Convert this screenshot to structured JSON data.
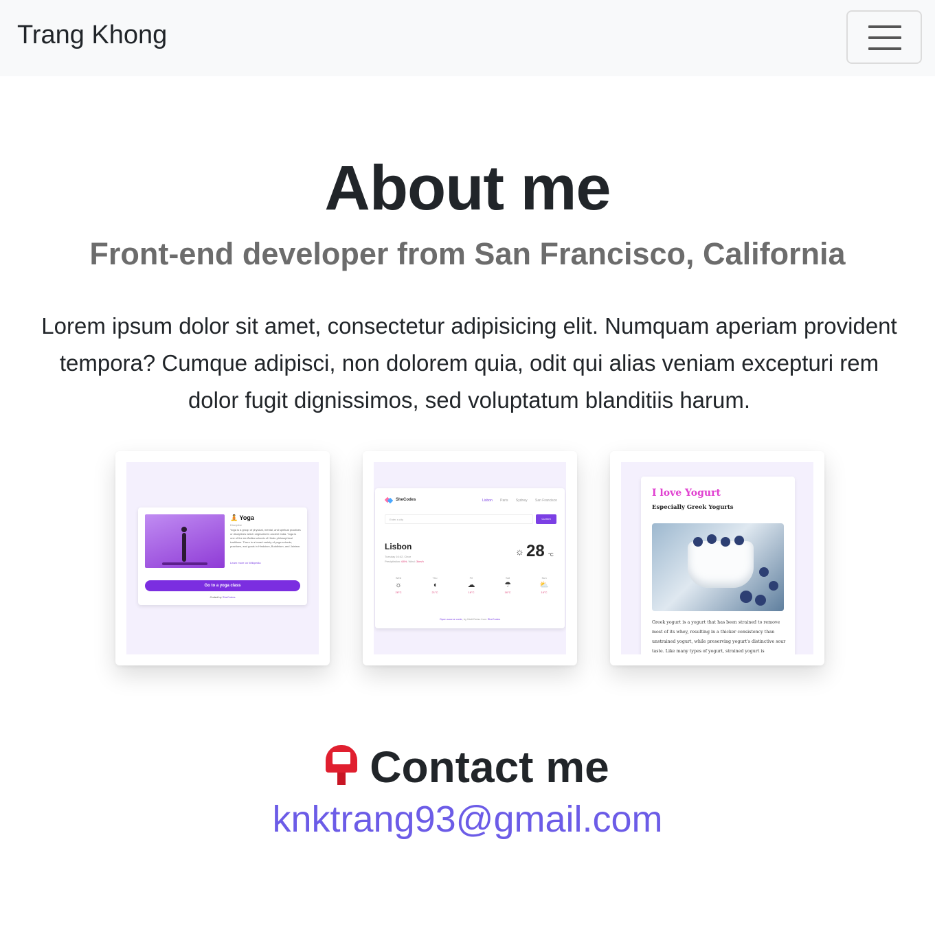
{
  "navbar": {
    "brand": "Trang Khong",
    "menu_icon": "hamburger-icon"
  },
  "about": {
    "title": "About me",
    "subtitle": "Front-end developer from San Francisco, California",
    "intro": "Lorem ipsum dolor sit amet, consectetur adipisicing elit. Numquam aperiam provident tempora? Cumque adipisci, non dolorem quia, odit qui alias veniam excepturi rem dolor fugit dignissimos, sed voluptatum blanditiis harum."
  },
  "projects": {
    "yoga": {
      "title": "🧘 Yoga",
      "discipline": "Discipline",
      "description": "Yoga is a group of physical, mental, and spiritual practices or disciplines which originated in ancient India. Yoga is one of the six Āstika schools of Hindu philosophical traditions. There is a broad variety of yoga schools, practices, and goals in Hinduism, Buddhism, and Jainism.",
      "link": "Learn more on Wikipedia",
      "button": "Go to a yoga class",
      "footer_prefix": "Coded by",
      "footer_link": "SheCodes"
    },
    "weather": {
      "brand": "SheCodes",
      "tabs": [
        "Lisbon",
        "Paris",
        "Sydney",
        "San Francisco"
      ],
      "search_placeholder": "Enter a city",
      "current_button": "Current",
      "city": "Lisbon",
      "date": "Tuesday 16:42, Clear",
      "precip_label": "Precipitation:",
      "precip_value": "68%",
      "wind_label": "Wind:",
      "wind_value": "3km/h",
      "temperature": "28",
      "unit": "°C",
      "forecast": [
        {
          "day": "Wed",
          "icon": "☼",
          "temp": "28°C"
        },
        {
          "day": "Thu",
          "icon": "◖",
          "temp": "21°C"
        },
        {
          "day": "Fri",
          "icon": "☁",
          "temp": "16°C"
        },
        {
          "day": "Sat",
          "icon": "☂",
          "temp": "16°C"
        },
        {
          "day": "Sun",
          "icon": "⛅",
          "temp": "16°C"
        }
      ],
      "footer_link1": "Open-source code",
      "footer_mid": ", by Matt Delac from",
      "footer_link2": "SheCodes"
    },
    "yogurt": {
      "title": "I love Yogurt",
      "subtitle": "Especially Greek Yogurts",
      "text": "Greek yogurt is a yogurt that has been strained to remove most of its whey, resulting in a thicker consistency than unstrained yogurt, while preserving yogurt's distinctive sour taste. Like many types of yogurt, strained yogurt is"
    }
  },
  "contact": {
    "title": "Contact me",
    "icon": "postbox-icon",
    "email": "knktrang93@gmail.com"
  },
  "colors": {
    "navbar_bg": "#f8f9fa",
    "link": "#6c5ce7",
    "subtitle": "#6c6c6c",
    "yoga_button": "#7b2ee0",
    "yogurt_title": "#e040d0",
    "postbox_red": "#e01f2f"
  }
}
